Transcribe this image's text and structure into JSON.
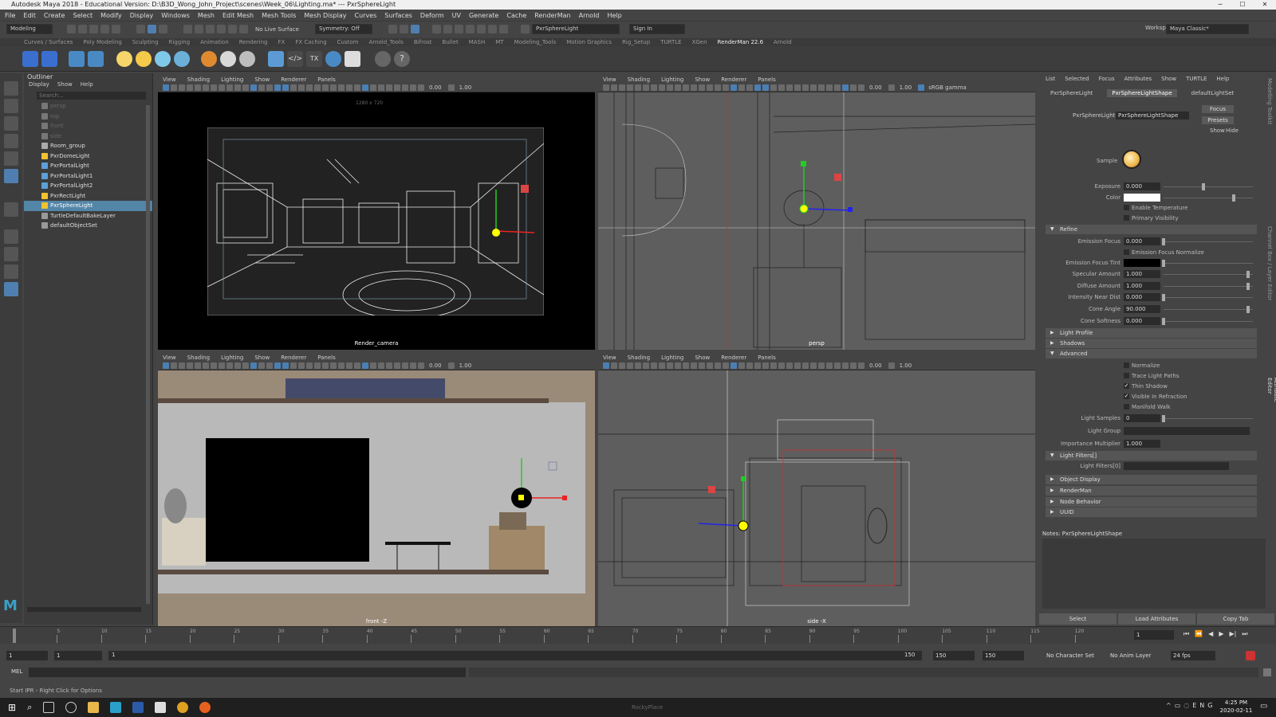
{
  "window": {
    "title": "Autodesk Maya 2018 - Educational Version: D:\\B3D_Wong_John_Project\\scenes\\Week_06\\Lighting.ma*  ---  PxrSphereLight"
  },
  "menubar": [
    "File",
    "Edit",
    "Create",
    "Select",
    "Modify",
    "Display",
    "Windows",
    "Mesh",
    "Edit Mesh",
    "Mesh Tools",
    "Mesh Display",
    "Curves",
    "Surfaces",
    "Deform",
    "UV",
    "Generate",
    "Cache",
    "RenderMan",
    "Arnold",
    "Help"
  ],
  "statusline": {
    "mode": "Modeling",
    "live": "No Live Surface",
    "symmetry": "Symmetry: Off",
    "object_field": "PxrSphereLight",
    "sign_in": "Sign In",
    "workspace_label": "Workspace :",
    "workspace": "Maya Classic*"
  },
  "shelf_tabs": [
    "Curves / Surfaces",
    "Poly Modeling",
    "Sculpting",
    "Rigging",
    "Animation",
    "Rendering",
    "FX",
    "FX Caching",
    "Custom",
    "Arnold_Tools",
    "Bifrost",
    "Bullet",
    "MASH",
    "MT",
    "Modeling_Tools",
    "Motion Graphics",
    "Rig_Setup",
    "TURTLE",
    "XGen",
    "RenderMan 22.6",
    "Arnold"
  ],
  "shelf_active": "RenderMan 22.6",
  "outliner": {
    "title": "Outliner",
    "menu": [
      "Display",
      "Show",
      "Help"
    ],
    "search_placeholder": "Search...",
    "items": [
      {
        "label": "persp",
        "dim": true
      },
      {
        "label": "top",
        "dim": true
      },
      {
        "label": "front",
        "dim": true
      },
      {
        "label": "side",
        "dim": true
      },
      {
        "label": "Room_group"
      },
      {
        "label": "PxrDomeLight"
      },
      {
        "label": "PxrPortalLight"
      },
      {
        "label": "PxrPortalLight1"
      },
      {
        "label": "PxrPortalLight2"
      },
      {
        "label": "PxrRectLight"
      },
      {
        "label": "PxrSphereLight",
        "selected": true
      },
      {
        "label": "TurtleDefaultBakeLayer"
      },
      {
        "label": "defaultObjectSet"
      }
    ]
  },
  "viewport_menu": [
    "View",
    "Shading",
    "Lighting",
    "Show",
    "Renderer",
    "Panels"
  ],
  "viewports": {
    "tl": {
      "camera": "Render_camera",
      "res": "1280 x 720",
      "val1": "0.00",
      "val2": "1.00"
    },
    "tr": {
      "camera": "persp",
      "val1": "0.00",
      "val2": "1.00",
      "colorspace": "sRGB gamma"
    },
    "bl": {
      "camera": "front -Z",
      "val1": "0.00",
      "val2": "1.00"
    },
    "br": {
      "camera": "side -X",
      "val1": "0.00",
      "val2": "1.00"
    }
  },
  "attr": {
    "menu": [
      "List",
      "Selected",
      "Focus",
      "Attributes",
      "Show",
      "TURTLE",
      "Help"
    ],
    "tabs": [
      "PxrSphereLight",
      "PxrSphereLightShape",
      "defaultLightSet"
    ],
    "node_label": "PxrSphereLight:",
    "node_value": "PxrSphereLightShape",
    "focus": "Focus",
    "presets": "Presets",
    "show": "Show",
    "hide": "Hide",
    "sample": "Sample",
    "exposure_label": "Exposure",
    "exposure": "0.000",
    "color_label": "Color",
    "enable_temp": "Enable Temperature",
    "primary_vis": "Primary Visibility",
    "refine": "Refine",
    "emission_focus_label": "Emission Focus",
    "emission_focus": "0.000",
    "efn": "Emission Focus Normalize",
    "eft": "Emission Focus Tint",
    "spec_label": "Specular Amount",
    "spec": "1.000",
    "diff_label": "Diffuse Amount",
    "diff": "1.000",
    "ind_label": "Intensity Near Dist",
    "ind": "0.000",
    "cone_label": "Cone Angle",
    "cone": "90.000",
    "soft_label": "Cone Softness",
    "soft": "0.000",
    "light_profile": "Light Profile",
    "shadows": "Shadows",
    "advanced": "Advanced",
    "normalize": "Normalize",
    "trace": "Trace Light Paths",
    "thin": "Thin Shadow",
    "refr": "Visible In Refraction",
    "manifold": "Manifold Walk",
    "samples_label": "Light Samples",
    "samples": "0",
    "group_label": "Light Group",
    "imp_label": "Importance Multiplier",
    "imp": "1.000",
    "filters": "Light Filters[]",
    "filters0": "Light Filters[0]",
    "object_display": "Object Display",
    "renderman": "RenderMan",
    "node_behavior": "Node Behavior",
    "uuid": "UUID",
    "notes": "Notes: PxrSphereLightShape",
    "btn_select": "Select",
    "btn_load": "Load Attributes",
    "btn_copy": "Copy Tab"
  },
  "side_tabs": [
    "Modelling Toolkit",
    "Attribute Editor",
    "Channel Box / Layer Editor"
  ],
  "timeline": {
    "ticks": [
      "1",
      "5",
      "10",
      "15",
      "20",
      "25",
      "30",
      "35",
      "40",
      "45",
      "50",
      "55",
      "60",
      "65",
      "70",
      "75",
      "80",
      "85",
      "90",
      "95",
      "100",
      "105",
      "110",
      "115",
      "120"
    ],
    "current": "1"
  },
  "range": {
    "start": "1",
    "start2": "1",
    "marker": "1",
    "end_a": "150",
    "end_b": "150",
    "end_c": "150",
    "char": "No Character Set",
    "anim": "No Anim Layer",
    "fps": "24 fps"
  },
  "cmd": {
    "label": "MEL"
  },
  "help": "Start IPR - Right Click for Options",
  "taskbar": {
    "time": "4:25 PM",
    "date": "2020-02-11",
    "app": "RockyPlace"
  }
}
